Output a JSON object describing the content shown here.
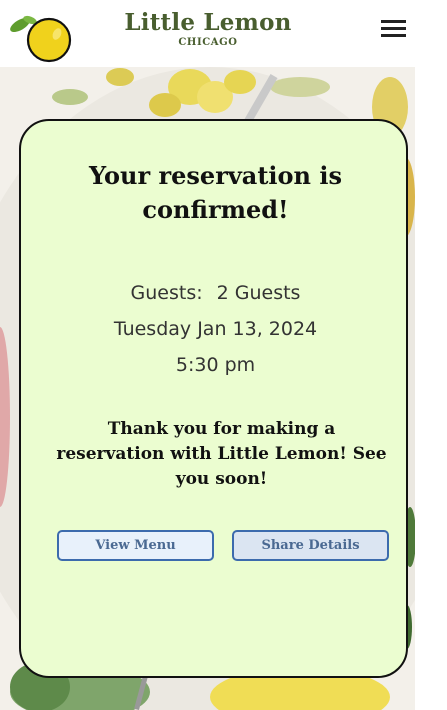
{
  "header": {
    "brand_name": "Little Lemon",
    "brand_city": "CHICAGO"
  },
  "card": {
    "title": "Your reservation is confirmed!",
    "guests_label": "Guests:",
    "guests_value": "2 Guests",
    "date": "Tuesday Jan 13, 2024",
    "time": "5:30 pm",
    "thanks": "Thank you for making a reservation with Little Lemon! See you soon!",
    "view_menu_label": "View Menu",
    "share_details_label": "Share Details"
  },
  "colors": {
    "brand_green": "#495e2f",
    "card_background": "#ebfdd0",
    "button_border": "#3c6bad",
    "button_text": "#4a6992"
  },
  "icons": {
    "logo": "lemon-logo-icon",
    "menu": "hamburger-menu-icon"
  }
}
